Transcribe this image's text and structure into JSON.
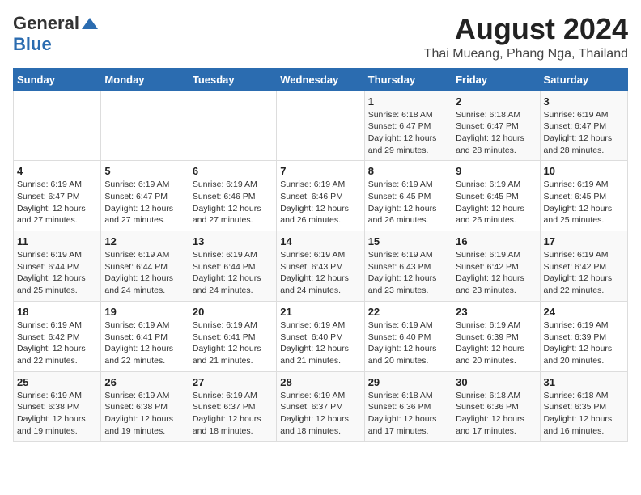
{
  "header": {
    "logo_general": "General",
    "logo_blue": "Blue",
    "month_year": "August 2024",
    "location": "Thai Mueang, Phang Nga, Thailand"
  },
  "weekdays": [
    "Sunday",
    "Monday",
    "Tuesday",
    "Wednesday",
    "Thursday",
    "Friday",
    "Saturday"
  ],
  "weeks": [
    [
      {
        "day": "",
        "info": ""
      },
      {
        "day": "",
        "info": ""
      },
      {
        "day": "",
        "info": ""
      },
      {
        "day": "",
        "info": ""
      },
      {
        "day": "1",
        "info": "Sunrise: 6:18 AM\nSunset: 6:47 PM\nDaylight: 12 hours\nand 29 minutes."
      },
      {
        "day": "2",
        "info": "Sunrise: 6:18 AM\nSunset: 6:47 PM\nDaylight: 12 hours\nand 28 minutes."
      },
      {
        "day": "3",
        "info": "Sunrise: 6:19 AM\nSunset: 6:47 PM\nDaylight: 12 hours\nand 28 minutes."
      }
    ],
    [
      {
        "day": "4",
        "info": "Sunrise: 6:19 AM\nSunset: 6:47 PM\nDaylight: 12 hours\nand 27 minutes."
      },
      {
        "day": "5",
        "info": "Sunrise: 6:19 AM\nSunset: 6:47 PM\nDaylight: 12 hours\nand 27 minutes."
      },
      {
        "day": "6",
        "info": "Sunrise: 6:19 AM\nSunset: 6:46 PM\nDaylight: 12 hours\nand 27 minutes."
      },
      {
        "day": "7",
        "info": "Sunrise: 6:19 AM\nSunset: 6:46 PM\nDaylight: 12 hours\nand 26 minutes."
      },
      {
        "day": "8",
        "info": "Sunrise: 6:19 AM\nSunset: 6:45 PM\nDaylight: 12 hours\nand 26 minutes."
      },
      {
        "day": "9",
        "info": "Sunrise: 6:19 AM\nSunset: 6:45 PM\nDaylight: 12 hours\nand 26 minutes."
      },
      {
        "day": "10",
        "info": "Sunrise: 6:19 AM\nSunset: 6:45 PM\nDaylight: 12 hours\nand 25 minutes."
      }
    ],
    [
      {
        "day": "11",
        "info": "Sunrise: 6:19 AM\nSunset: 6:44 PM\nDaylight: 12 hours\nand 25 minutes."
      },
      {
        "day": "12",
        "info": "Sunrise: 6:19 AM\nSunset: 6:44 PM\nDaylight: 12 hours\nand 24 minutes."
      },
      {
        "day": "13",
        "info": "Sunrise: 6:19 AM\nSunset: 6:44 PM\nDaylight: 12 hours\nand 24 minutes."
      },
      {
        "day": "14",
        "info": "Sunrise: 6:19 AM\nSunset: 6:43 PM\nDaylight: 12 hours\nand 24 minutes."
      },
      {
        "day": "15",
        "info": "Sunrise: 6:19 AM\nSunset: 6:43 PM\nDaylight: 12 hours\nand 23 minutes."
      },
      {
        "day": "16",
        "info": "Sunrise: 6:19 AM\nSunset: 6:42 PM\nDaylight: 12 hours\nand 23 minutes."
      },
      {
        "day": "17",
        "info": "Sunrise: 6:19 AM\nSunset: 6:42 PM\nDaylight: 12 hours\nand 22 minutes."
      }
    ],
    [
      {
        "day": "18",
        "info": "Sunrise: 6:19 AM\nSunset: 6:42 PM\nDaylight: 12 hours\nand 22 minutes."
      },
      {
        "day": "19",
        "info": "Sunrise: 6:19 AM\nSunset: 6:41 PM\nDaylight: 12 hours\nand 22 minutes."
      },
      {
        "day": "20",
        "info": "Sunrise: 6:19 AM\nSunset: 6:41 PM\nDaylight: 12 hours\nand 21 minutes."
      },
      {
        "day": "21",
        "info": "Sunrise: 6:19 AM\nSunset: 6:40 PM\nDaylight: 12 hours\nand 21 minutes."
      },
      {
        "day": "22",
        "info": "Sunrise: 6:19 AM\nSunset: 6:40 PM\nDaylight: 12 hours\nand 20 minutes."
      },
      {
        "day": "23",
        "info": "Sunrise: 6:19 AM\nSunset: 6:39 PM\nDaylight: 12 hours\nand 20 minutes."
      },
      {
        "day": "24",
        "info": "Sunrise: 6:19 AM\nSunset: 6:39 PM\nDaylight: 12 hours\nand 20 minutes."
      }
    ],
    [
      {
        "day": "25",
        "info": "Sunrise: 6:19 AM\nSunset: 6:38 PM\nDaylight: 12 hours\nand 19 minutes."
      },
      {
        "day": "26",
        "info": "Sunrise: 6:19 AM\nSunset: 6:38 PM\nDaylight: 12 hours\nand 19 minutes."
      },
      {
        "day": "27",
        "info": "Sunrise: 6:19 AM\nSunset: 6:37 PM\nDaylight: 12 hours\nand 18 minutes."
      },
      {
        "day": "28",
        "info": "Sunrise: 6:19 AM\nSunset: 6:37 PM\nDaylight: 12 hours\nand 18 minutes."
      },
      {
        "day": "29",
        "info": "Sunrise: 6:18 AM\nSunset: 6:36 PM\nDaylight: 12 hours\nand 17 minutes."
      },
      {
        "day": "30",
        "info": "Sunrise: 6:18 AM\nSunset: 6:36 PM\nDaylight: 12 hours\nand 17 minutes."
      },
      {
        "day": "31",
        "info": "Sunrise: 6:18 AM\nSunset: 6:35 PM\nDaylight: 12 hours\nand 16 minutes."
      }
    ]
  ]
}
